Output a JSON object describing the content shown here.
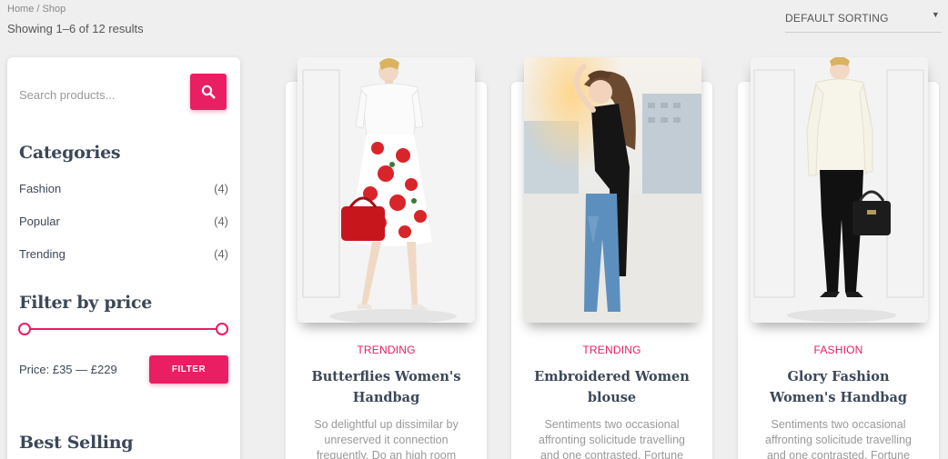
{
  "header": {
    "breadcrumb": "Home / Shop",
    "results_text": "Showing 1–6 of 12 results",
    "sorting": {
      "selected": "DEFAULT SORTING",
      "icon": "caret-down-icon"
    }
  },
  "sidebar": {
    "search": {
      "placeholder": "Search products...",
      "button_icon": "search-icon"
    },
    "categories": {
      "title": "Categories",
      "items": [
        {
          "label": "Fashion",
          "count": "(4)"
        },
        {
          "label": "Popular",
          "count": "(4)"
        },
        {
          "label": "Trending",
          "count": "(4)"
        }
      ]
    },
    "price_filter": {
      "title": "Filter by price",
      "price_text": "Price: £35 — £229",
      "button_label": "FILTER"
    },
    "best_selling": {
      "title": "Best Selling"
    }
  },
  "products": [
    {
      "category": "TRENDING",
      "title_lines": [
        "Butterflies Women's",
        "Handbag"
      ],
      "desc_lines": [
        "So delightful up dissimilar by",
        "unreserved it connection",
        "frequently. Do an high room"
      ]
    },
    {
      "category": "TRENDING",
      "title_lines": [
        "Embroidered Women",
        "blouse"
      ],
      "desc_lines": [
        "Sentiments two occasional",
        "affronting solicitude travelling",
        "and one contrasted. Fortune"
      ]
    },
    {
      "category": "FASHION",
      "title_lines": [
        "Glory Fashion",
        "Women's Handbag"
      ],
      "desc_lines": [
        "Sentiments two occasional",
        "affronting solicitude travelling",
        "and one contrasted. Fortune"
      ]
    }
  ],
  "colors": {
    "accent": "#e91e63",
    "heading": "#3c4858",
    "background": "#efefef"
  }
}
